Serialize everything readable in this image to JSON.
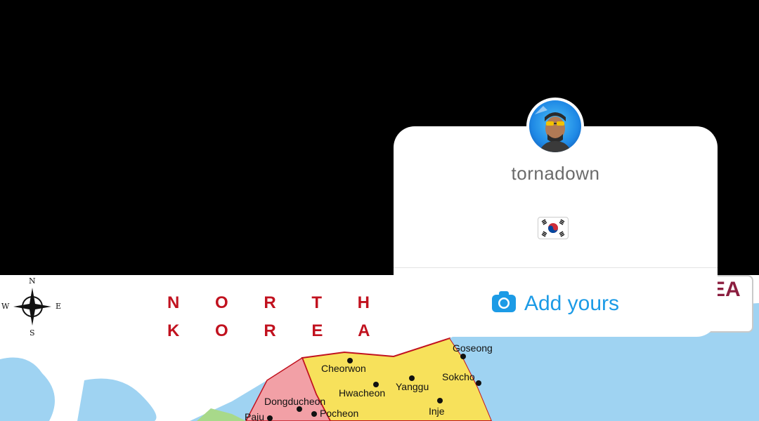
{
  "story": {
    "username": "tornadown",
    "flag_icon": "south-korea-flag",
    "add_yours_label": "Add yours",
    "camera_icon": "camera-icon",
    "accent_color": "#1c9be6"
  },
  "map": {
    "country_lines": [
      "N O R T H",
      "K O R E A"
    ],
    "title_partial": "EA",
    "compass": {
      "n": "N",
      "s": "S",
      "w": "W",
      "e": "E"
    },
    "cities": [
      {
        "name": "Goseong"
      },
      {
        "name": "Cheorwon"
      },
      {
        "name": "Sokcho"
      },
      {
        "name": "Hwacheon"
      },
      {
        "name": "Yanggu"
      },
      {
        "name": "Dongducheon"
      },
      {
        "name": "Inje"
      },
      {
        "name": "Pocheon"
      },
      {
        "name": "Paju"
      }
    ],
    "colors": {
      "sea": "#9fd3f2",
      "north": "#ffffff",
      "yellow": "#f7e15b",
      "pink": "#f2a0a6",
      "green": "#a8d98a"
    }
  }
}
